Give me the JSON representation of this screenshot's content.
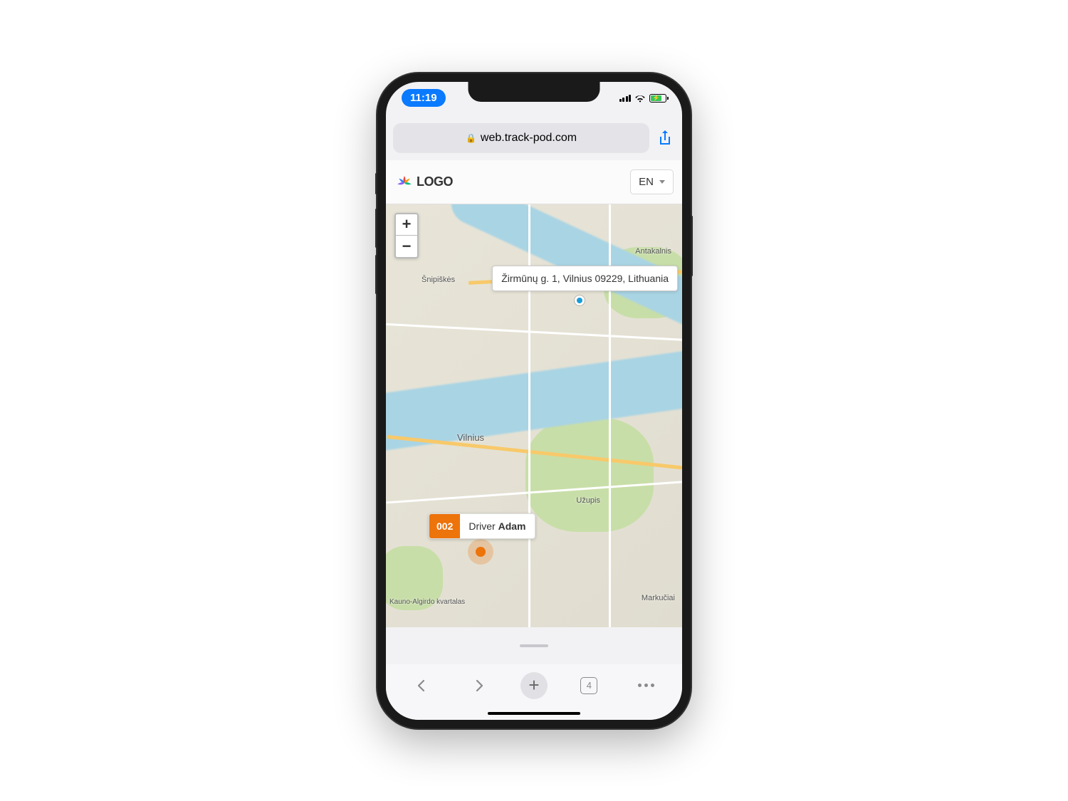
{
  "status_bar": {
    "time": "11:19"
  },
  "browser": {
    "url": "web.track-pod.com",
    "tab_count": "4"
  },
  "app": {
    "logo_text": "LOGO",
    "lang": "EN"
  },
  "map": {
    "zoom_in": "+",
    "zoom_out": "−",
    "destination": {
      "address": "Žirmūnų g. 1, Vilnius 09229, Lithuania"
    },
    "driver": {
      "code": "002",
      "role": "Driver",
      "name": "Adam"
    },
    "labels": {
      "vilnius": "Vilnius",
      "snipiskes": "Šnipiškės",
      "antakalnis": "Antakalnis",
      "uzupis": "Užupis",
      "markuciai": "Markučiai",
      "kauno": "Kauno-Algirdo kvartalas"
    }
  }
}
